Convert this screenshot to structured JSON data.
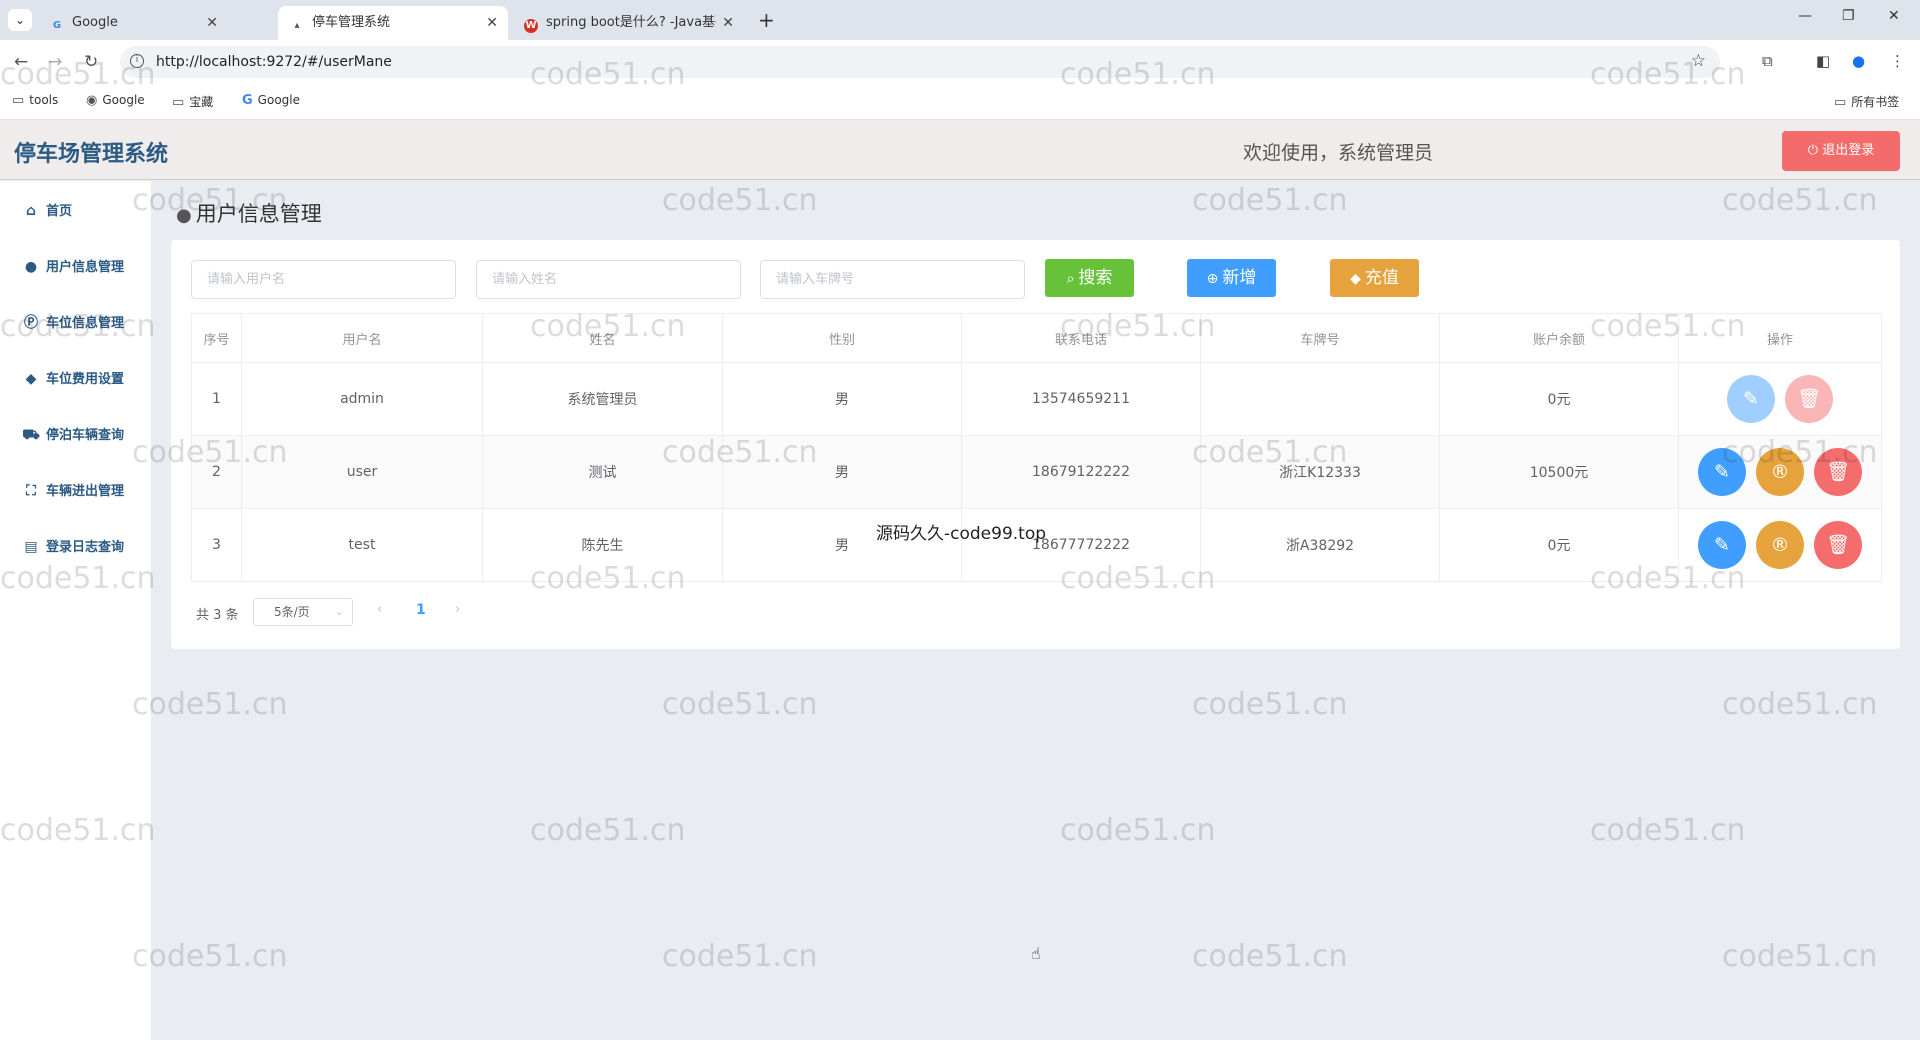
{
  "browser": {
    "tabs": [
      {
        "label": "Google",
        "icon": "G",
        "icon_color": "#4285f4"
      },
      {
        "label": "停车管理系统",
        "icon": "▴",
        "icon_color": "#555555"
      },
      {
        "label": "spring boot是什么? -Java基础",
        "icon": "W",
        "icon_color": "#d93025"
      }
    ],
    "url": "http://localhost:9272/#/userMane",
    "bookmarks": [
      "tools",
      "Google",
      "宝藏",
      "Google"
    ],
    "all_bookmarks": "所有书签"
  },
  "app": {
    "title": "停车场管理系统",
    "welcome": "欢迎使用，系统管理员",
    "logout": "退出登录"
  },
  "sidebar": {
    "items": [
      {
        "label": "首页",
        "icon": "home-icon"
      },
      {
        "label": "用户信息管理",
        "icon": "user-icon"
      },
      {
        "label": "车位信息管理",
        "icon": "parking-icon"
      },
      {
        "label": "车位费用设置",
        "icon": "tag-icon"
      },
      {
        "label": "停泊车辆查询",
        "icon": "car-icon"
      },
      {
        "label": "车辆进出管理",
        "icon": "scan-icon"
      },
      {
        "label": "登录日志查询",
        "icon": "log-icon"
      }
    ]
  },
  "page": {
    "title": "用户信息管理",
    "search": {
      "username_placeholder": "请输入用户名",
      "name_placeholder": "请输入姓名",
      "plate_placeholder": "请输入车牌号"
    },
    "buttons": {
      "search": "搜索",
      "add": "新增",
      "recharge": "充值"
    },
    "table": {
      "headers": [
        "序号",
        "用户名",
        "姓名",
        "性别",
        "联系电话",
        "车牌号",
        "账户余额",
        "操作"
      ],
      "rows": [
        {
          "index": "1",
          "username": "admin",
          "name": "系统管理员",
          "gender": "男",
          "phone": "13574659211",
          "plate": "",
          "balance": "0元"
        },
        {
          "index": "2",
          "username": "user",
          "name": "测试",
          "gender": "男",
          "phone": "18679122222",
          "plate": "浙江K12333",
          "balance": "10500元"
        },
        {
          "index": "3",
          "username": "test",
          "name": "陈先生",
          "gender": "男",
          "phone": "18677772222",
          "plate": "浙A38292",
          "balance": "0元"
        }
      ]
    },
    "pagination": {
      "total": "共 3 条",
      "page_size": "5条/页",
      "current": "1"
    }
  },
  "watermark": {
    "text": "code51.cn",
    "overlay": "源码久久-code99.top"
  },
  "colors": {
    "primary": "#409eff",
    "success": "#67c23a",
    "warning": "#e6a23c",
    "danger": "#f56c6c",
    "brand": "#2b5a84"
  }
}
